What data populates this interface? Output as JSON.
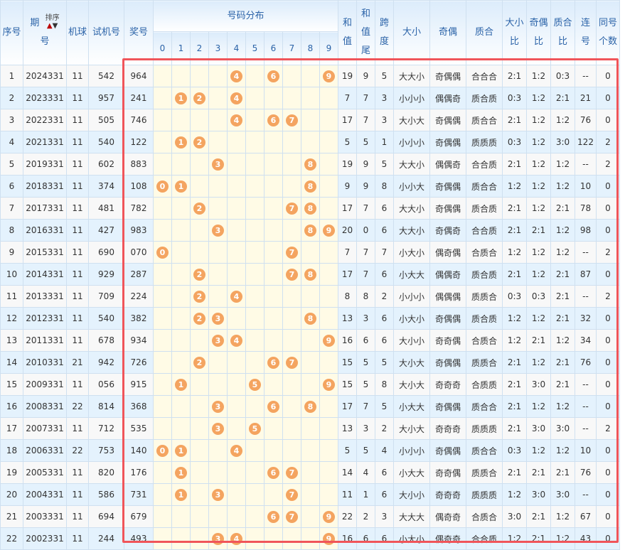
{
  "headers": {
    "seq": "序号",
    "period_a": "期",
    "period_b": "号",
    "sort_label": "排序",
    "ball": "机球",
    "trial": "试机号",
    "prize": "奖号",
    "distribution": "号码分布",
    "digits": [
      "0",
      "1",
      "2",
      "3",
      "4",
      "5",
      "6",
      "7",
      "8",
      "9"
    ],
    "sum_a": "和",
    "sum_b": "值",
    "tail_a": "和",
    "tail_b": "值",
    "tail_c": "尾",
    "span_a": "跨",
    "span_b": "度",
    "size": "大小",
    "oddeven": "奇偶",
    "primecomp": "质合",
    "size_ratio_a": "大小",
    "size_ratio_b": "比",
    "oe_ratio_a": "奇偶",
    "oe_ratio_b": "比",
    "pc_ratio_a": "质合",
    "pc_ratio_b": "比",
    "consec_a": "连",
    "consec_b": "号",
    "same_a": "同号",
    "same_b": "个数"
  },
  "colors": {
    "ball": "#f4a460",
    "highlight": "#f0555a",
    "header_text": "#2b63a8"
  },
  "rows": [
    [
      "1",
      "2024331",
      "11",
      "542",
      "964",
      "19",
      "9",
      "5",
      "大大小",
      "奇偶偶",
      "合合合",
      "2:1",
      "1:2",
      "0:3",
      "--",
      "0"
    ],
    [
      "2",
      "2023331",
      "11",
      "957",
      "241",
      "7",
      "7",
      "3",
      "小小小",
      "偶偶奇",
      "质合质",
      "0:3",
      "1:2",
      "2:1",
      "21",
      "0"
    ],
    [
      "3",
      "2022331",
      "11",
      "505",
      "746",
      "17",
      "7",
      "3",
      "大小大",
      "奇偶偶",
      "质合合",
      "2:1",
      "1:2",
      "1:2",
      "76",
      "0"
    ],
    [
      "4",
      "2021331",
      "11",
      "540",
      "122",
      "5",
      "5",
      "1",
      "小小小",
      "奇偶偶",
      "质质质",
      "0:3",
      "1:2",
      "3:0",
      "122",
      "2"
    ],
    [
      "5",
      "2019331",
      "11",
      "602",
      "883",
      "19",
      "9",
      "5",
      "大大小",
      "偶偶奇",
      "合合质",
      "2:1",
      "1:2",
      "1:2",
      "--",
      "2"
    ],
    [
      "6",
      "2018331",
      "11",
      "374",
      "108",
      "9",
      "9",
      "8",
      "小小大",
      "奇偶偶",
      "质合合",
      "1:2",
      "1:2",
      "1:2",
      "10",
      "0"
    ],
    [
      "7",
      "2017331",
      "11",
      "481",
      "782",
      "17",
      "7",
      "6",
      "大大小",
      "奇偶偶",
      "质合质",
      "2:1",
      "1:2",
      "2:1",
      "78",
      "0"
    ],
    [
      "8",
      "2016331",
      "11",
      "427",
      "983",
      "20",
      "0",
      "6",
      "大大小",
      "奇偶奇",
      "合合质",
      "2:1",
      "2:1",
      "1:2",
      "98",
      "0"
    ],
    [
      "9",
      "2015331",
      "11",
      "690",
      "070",
      "7",
      "7",
      "7",
      "小大小",
      "偶奇偶",
      "合质合",
      "1:2",
      "1:2",
      "1:2",
      "--",
      "2"
    ],
    [
      "10",
      "2014331",
      "11",
      "929",
      "287",
      "17",
      "7",
      "6",
      "小大大",
      "偶偶奇",
      "质合质",
      "2:1",
      "1:2",
      "2:1",
      "87",
      "0"
    ],
    [
      "11",
      "2013331",
      "11",
      "709",
      "224",
      "8",
      "8",
      "2",
      "小小小",
      "偶偶偶",
      "质质合",
      "0:3",
      "0:3",
      "2:1",
      "--",
      "2"
    ],
    [
      "12",
      "2012331",
      "11",
      "540",
      "382",
      "13",
      "3",
      "6",
      "小大小",
      "奇偶偶",
      "质合质",
      "1:2",
      "1:2",
      "2:1",
      "32",
      "0"
    ],
    [
      "13",
      "2011331",
      "11",
      "678",
      "934",
      "16",
      "6",
      "6",
      "大小小",
      "奇奇偶",
      "合质合",
      "1:2",
      "2:1",
      "1:2",
      "34",
      "0"
    ],
    [
      "14",
      "2010331",
      "21",
      "942",
      "726",
      "15",
      "5",
      "5",
      "大小大",
      "奇偶偶",
      "质质合",
      "2:1",
      "1:2",
      "2:1",
      "76",
      "0"
    ],
    [
      "15",
      "2009331",
      "11",
      "056",
      "915",
      "15",
      "5",
      "8",
      "大小大",
      "奇奇奇",
      "合质质",
      "2:1",
      "3:0",
      "2:1",
      "--",
      "0"
    ],
    [
      "16",
      "2008331",
      "22",
      "814",
      "368",
      "17",
      "7",
      "5",
      "小大大",
      "奇偶偶",
      "质合合",
      "2:1",
      "1:2",
      "1:2",
      "--",
      "0"
    ],
    [
      "17",
      "2007331",
      "11",
      "712",
      "535",
      "13",
      "3",
      "2",
      "大小大",
      "奇奇奇",
      "质质质",
      "2:1",
      "3:0",
      "3:0",
      "--",
      "2"
    ],
    [
      "18",
      "2006331",
      "22",
      "753",
      "140",
      "5",
      "5",
      "4",
      "小小小",
      "奇偶偶",
      "质合合",
      "0:3",
      "1:2",
      "1:2",
      "10",
      "0"
    ],
    [
      "19",
      "2005331",
      "11",
      "820",
      "176",
      "14",
      "4",
      "6",
      "小大大",
      "奇奇偶",
      "质质合",
      "2:1",
      "2:1",
      "2:1",
      "76",
      "0"
    ],
    [
      "20",
      "2004331",
      "11",
      "586",
      "731",
      "11",
      "1",
      "6",
      "大小小",
      "奇奇奇",
      "质质质",
      "1:2",
      "3:0",
      "3:0",
      "--",
      "0"
    ],
    [
      "21",
      "2003331",
      "11",
      "694",
      "679",
      "22",
      "2",
      "3",
      "大大大",
      "偶奇奇",
      "合质合",
      "3:0",
      "2:1",
      "1:2",
      "67",
      "0"
    ],
    [
      "22",
      "2002331",
      "11",
      "244",
      "493",
      "16",
      "6",
      "6",
      "小大小",
      "偶奇奇",
      "合合质",
      "1:2",
      "2:1",
      "1:2",
      "43",
      "0"
    ]
  ]
}
